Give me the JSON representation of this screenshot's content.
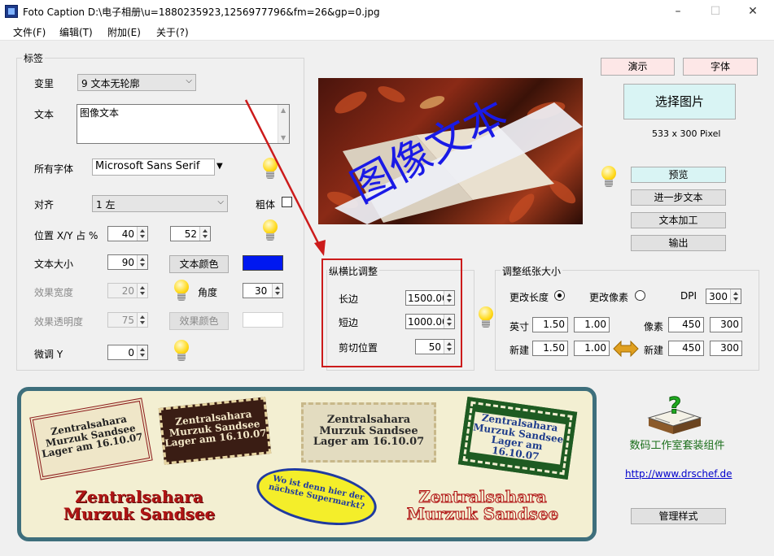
{
  "window": {
    "title": "Foto Caption D:\\电子相册\\u=1880235923,1256977796&fm=26&gp=0.jpg",
    "minimize": "–",
    "maximize": "☐",
    "close": "✕"
  },
  "menu": [
    "文件(F)",
    "编辑(T)",
    "附加(E)",
    "关于(?)"
  ],
  "label_group": {
    "title": "标签",
    "variant_label": "变里",
    "variant_value": "9 文本无轮廓",
    "text_label": "文本",
    "text_value": "图像文本",
    "font_label": "所有字体",
    "font_value": "Microsoft Sans Serif",
    "align_label": "对齐",
    "align_value": "1 左",
    "bold_label": "粗体",
    "pos_label": "位置 X/Y 占 %",
    "pos_x": "40",
    "pos_y": "52",
    "size_label": "文本大小",
    "size_value": "90",
    "text_color_button": "文本颜色",
    "text_color": "#0018f0",
    "effect_width_label": "效果宽度",
    "effect_width_value": "20",
    "angle_label": "角度",
    "angle_value": "30",
    "effect_opacity_label": "效果透明度",
    "effect_opacity_value": "75",
    "effect_color_button": "效果颜色",
    "fine_y_label": "微调 Y",
    "fine_y_value": "0"
  },
  "preview": {
    "overlay_text": "图像文本",
    "pixel_info": "533 x 300 Pixel"
  },
  "buttons": {
    "demo": "演示",
    "font": "字体",
    "select_image": "选择图片",
    "preview": "预览",
    "further_text": "进一步文本",
    "text_processing": "文本加工",
    "output": "输出",
    "manage_styles": "管理样式"
  },
  "aspect_group": {
    "title": "纵横比调整",
    "long_label": "长边",
    "long_value": "1500.00",
    "short_label": "短边",
    "short_value": "1000.00",
    "crop_label": "剪切位置",
    "crop_value": "50"
  },
  "paper_group": {
    "title": "调整纸张大小",
    "change_length": "更改长度",
    "change_pixel": "更改像素",
    "dpi_label": "DPI",
    "dpi_value": "300",
    "inch_label": "英寸",
    "inch_w": "1.50",
    "inch_h": "1.00",
    "pixel_label": "像素",
    "pixel_w": "450",
    "pixel_h": "300",
    "new_label": "新建",
    "new_inch_w": "1.50",
    "new_inch_h": "1.00",
    "new_label2": "新建",
    "new_pixel_w": "450",
    "new_pixel_h": "300"
  },
  "banner": {
    "sticker1": [
      "Zentralsahara",
      "Murzuk Sandsee",
      "Lager am 16.10.07"
    ],
    "sticker2": [
      "Zentralsahara",
      "Murzuk Sandsee",
      "Lager am 16.10.07"
    ],
    "sticker3": [
      "Zentralsahara",
      "Murzuk Sandsee",
      "Lager am 16.10.07"
    ],
    "sticker4": [
      "Zentralsahara",
      "Murzuk Sandsee",
      "Lager am 16.10.07"
    ],
    "oval": [
      "Wo ist denn hier der",
      "nächste Supermarkt?"
    ],
    "red1": [
      "Zentralsahara",
      "Murzuk Sandsee"
    ],
    "red2": [
      "Zentralsahara",
      "Murzuk Sandsee"
    ]
  },
  "suite": {
    "name": "数码工作室套装组件",
    "url": "http://www.drschef.de"
  },
  "colors": {
    "annotation_red": "#cc1b1b",
    "banner_border": "#3e6f7c",
    "banner_bg": "#f3efd2"
  }
}
